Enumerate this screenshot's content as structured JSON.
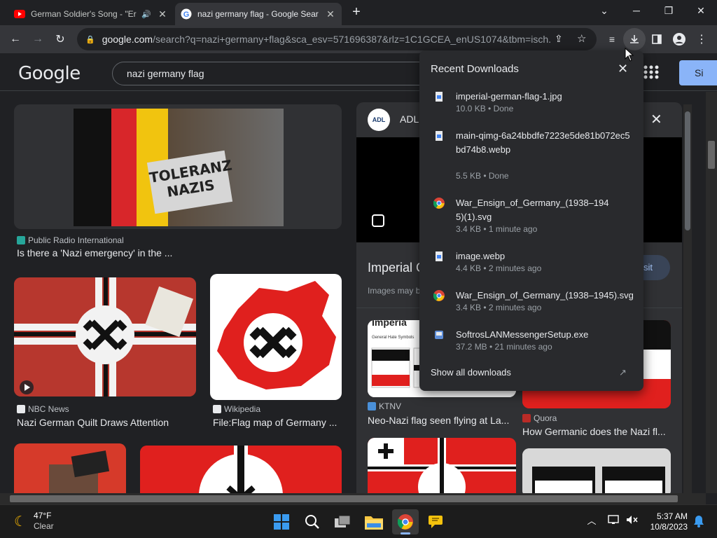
{
  "tabs": [
    {
      "title": "German Soldier's Song - \"Er",
      "favicon": "youtube-icon"
    },
    {
      "title": "nazi germany flag - Google Sear",
      "favicon": "google-icon"
    }
  ],
  "toolbar": {
    "url_host": "google.com",
    "url_path": "/search?q=nazi+germany+flag&sca_esv=571696387&rlz=1C1GCEA_enUS1074&tbm=isch..."
  },
  "google": {
    "logo": "Google",
    "query": "nazi germany flag",
    "signin_label": "Si"
  },
  "results": [
    {
      "source": "Public Radio International",
      "caption": "Is there a 'Nazi emergency' in the ...",
      "sign_text": "TOLERANZ NAZIS"
    },
    {
      "source": "NBC News",
      "caption": "Nazi German Quilt Draws Attention"
    },
    {
      "source": "Wikipedia",
      "caption": "File:Flag map of Germany ..."
    },
    {
      "source": "KTNV",
      "caption": "Neo-Nazi flag seen flying at La..."
    },
    {
      "source": "Quora",
      "caption": "How Germanic does the Nazi fl..."
    }
  ],
  "side_panel": {
    "source_badge": "ADL",
    "source_name": "ADL",
    "title": "Imperial G",
    "subtitle": "Images may b",
    "visit_label": "sit",
    "thumb_heading": "Imperia",
    "thumb_subheading": "General Hate Symbols"
  },
  "downloads": {
    "heading": "Recent Downloads",
    "items": [
      {
        "name": "imperial-german-flag-1.jpg",
        "meta": "10.0 KB • Done",
        "icon": "file-icon"
      },
      {
        "name": "main-qimg-6a24bbdfe7223e5de81b072ec5bd74b8.webp",
        "meta": "5.5 KB • Done",
        "icon": "file-icon"
      },
      {
        "name": "War_Ensign_of_Germany_(1938–1945)(1).svg",
        "meta": "3.4 KB • 1 minute ago",
        "icon": "chrome-icon"
      },
      {
        "name": "image.webp",
        "meta": "4.4 KB • 2 minutes ago",
        "icon": "file-icon"
      },
      {
        "name": "War_Ensign_of_Germany_(1938–1945).svg",
        "meta": "3.4 KB • 2 minutes ago",
        "icon": "chrome-icon"
      },
      {
        "name": "SoftrosLANMessengerSetup.exe",
        "meta": "37.2 MB • 21 minutes ago",
        "icon": "installer-icon"
      }
    ],
    "show_all_label": "Show all downloads"
  },
  "taskbar": {
    "temperature": "47°F",
    "condition": "Clear",
    "time": "5:37 AM",
    "date": "10/8/2023"
  },
  "colors": {
    "accent": "#8ab4f8",
    "background": "#202124",
    "flag_red": "#e0201e"
  }
}
